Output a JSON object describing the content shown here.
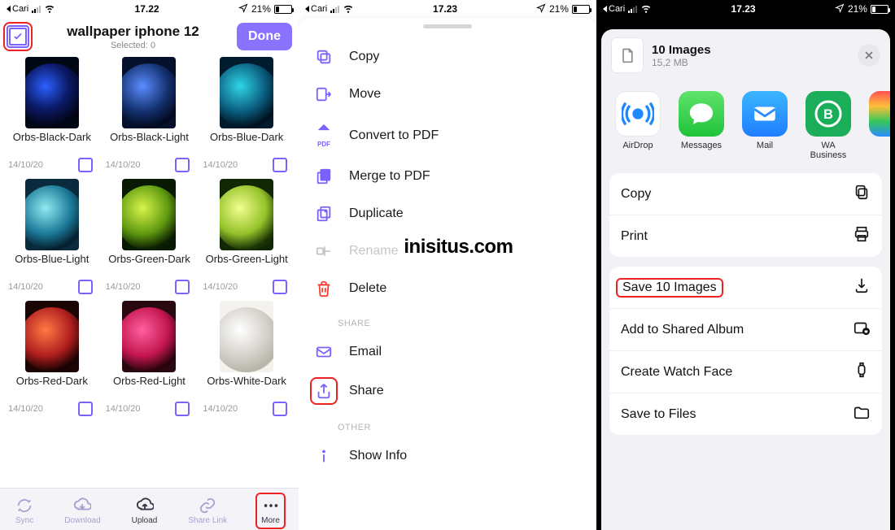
{
  "statusbar": {
    "carrier_back": "Cari",
    "time1": "17.22",
    "time2": "17.23",
    "time3": "17.23",
    "battery_pct": "21%"
  },
  "panel1": {
    "title": "wallpaper iphone 12",
    "subtitle": "Selected: 0",
    "done": "Done",
    "items": [
      {
        "name": "Orbs-Black-Dark",
        "date": "14/10/20",
        "bg": "#000814",
        "orb": "radial-gradient(circle at 40% 35%, #2b60ff, #0b1a66 40%, #020515 70%)"
      },
      {
        "name": "Orbs-Black-Light",
        "date": "14/10/20",
        "bg": "#04102c",
        "orb": "radial-gradient(circle at 40% 35%, #5a8dff, #13306e 45%, #030a20 72%)"
      },
      {
        "name": "Orbs-Blue-Dark",
        "date": "14/10/20",
        "bg": "#001a2e",
        "orb": "radial-gradient(circle at 40% 35%, #2fd6e8, #0a5c7d 45%, #00121f 72%)"
      },
      {
        "name": "Orbs-Blue-Light",
        "date": "14/10/20",
        "bg": "#0a2a3e",
        "orb": "radial-gradient(circle at 40% 35%, #8feaf0, #1c7a99 45%, #05202f 72%)"
      },
      {
        "name": "Orbs-Green-Dark",
        "date": "14/10/20",
        "bg": "#081a04",
        "orb": "radial-gradient(circle at 40% 35%, #d8f54a, #5f9a10 45%, #0b1d02 72%)"
      },
      {
        "name": "Orbs-Green-Light",
        "date": "14/10/20",
        "bg": "#122805",
        "orb": "radial-gradient(circle at 40% 35%, #f1ff8f, #95c22a 45%, #1a3305 72%)"
      },
      {
        "name": "Orbs-Red-Dark",
        "date": "14/10/20",
        "bg": "#1a0404",
        "orb": "radial-gradient(circle at 40% 35%, #ff7a45, #b01e1e 45%, #1a0202 72%)"
      },
      {
        "name": "Orbs-Red-Light",
        "date": "14/10/20",
        "bg": "#2a0810",
        "orb": "radial-gradient(circle at 40% 35%, #ff5fa0, #c4164f 45%, #2a030e 72%)"
      },
      {
        "name": "Orbs-White-Dark",
        "date": "14/10/20",
        "bg": "#f3f2ee",
        "orb": "radial-gradient(circle at 40% 35%, #ffffff, #d6d3cc 45%, #b9b5ab 72%)"
      }
    ],
    "footer": {
      "sync": "Sync",
      "download": "Download",
      "upload": "Upload",
      "sharelink": "Share Link",
      "more": "More"
    }
  },
  "panel2": {
    "items": {
      "copy": "Copy",
      "move": "Move",
      "to_pdf": "Convert to PDF",
      "merge_pdf": "Merge to PDF",
      "duplicate": "Duplicate",
      "rename": "Rename",
      "delete": "Delete",
      "email": "Email",
      "share": "Share",
      "showinfo": "Show Info"
    },
    "section_share": "SHARE",
    "section_other": "OTHER",
    "pdf_badge": "PDF",
    "watermark": "inisitus.com"
  },
  "panel3": {
    "head_title": "10 Images",
    "head_size": "15,2 MB",
    "apps": [
      {
        "label": "AirDrop",
        "bg": "#fff",
        "fg": "#1e88ff",
        "kind": "airdrop"
      },
      {
        "label": "Messages",
        "bg": "linear-gradient(#5fe36a,#20c33a)",
        "kind": "messages"
      },
      {
        "label": "Mail",
        "bg": "linear-gradient(#3bb6ff,#1f7dff)",
        "kind": "mail"
      },
      {
        "label": "WA Business",
        "bg": "#1aae5a",
        "kind": "wab"
      }
    ],
    "actions_top": [
      {
        "label": "Copy",
        "icon": "copy"
      },
      {
        "label": "Print",
        "icon": "print"
      }
    ],
    "actions_bottom": [
      {
        "label": "Save 10 Images",
        "icon": "download",
        "hl": true
      },
      {
        "label": "Add to Shared Album",
        "icon": "album"
      },
      {
        "label": "Create Watch Face",
        "icon": "watch"
      },
      {
        "label": "Save to Files",
        "icon": "folder"
      }
    ]
  }
}
